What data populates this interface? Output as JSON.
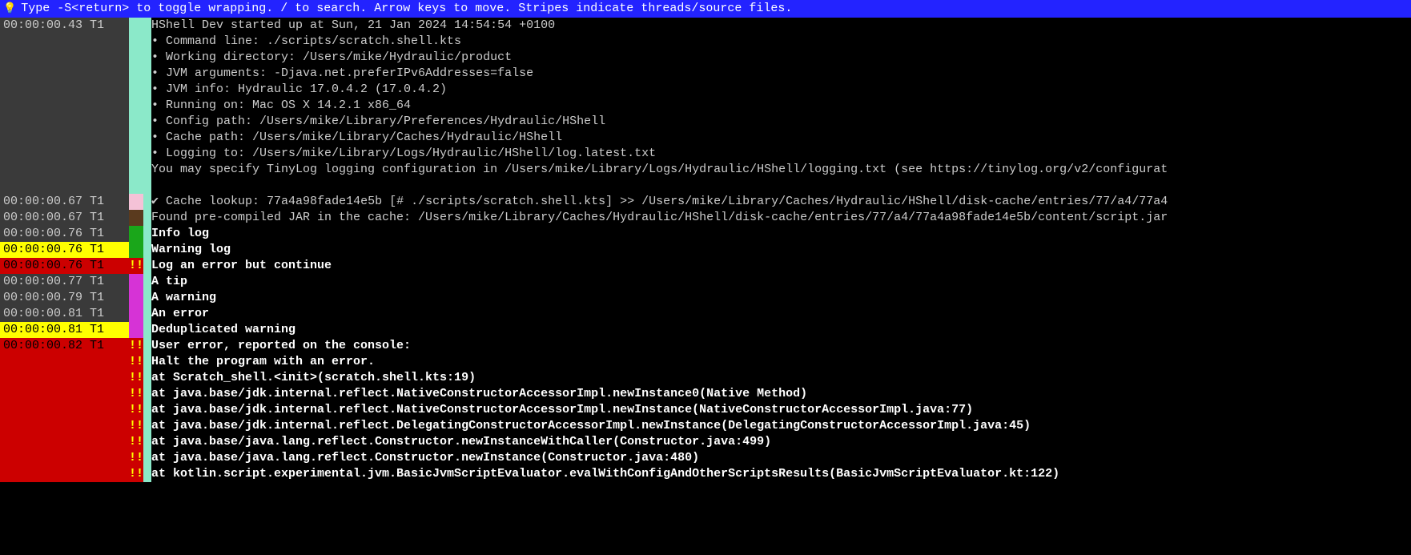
{
  "header": {
    "hint": "Type -S<return> to toggle wrapping. / to search. Arrow keys to move. Stripes indicate threads/source files."
  },
  "rows": [
    {
      "ts": "00:00:00.43 T1",
      "tsClass": "",
      "mark": "",
      "markClass": "",
      "msg": "HShell Dev started up at Sun, 21 Jan 2024 14:54:54 +0100",
      "bold": false
    },
    {
      "ts": "",
      "tsClass": "",
      "mark": "",
      "markClass": "",
      "msg": " • Command line:      ./scripts/scratch.shell.kts",
      "bold": false
    },
    {
      "ts": "",
      "tsClass": "",
      "mark": "",
      "markClass": "",
      "msg": " • Working directory: /Users/mike/Hydraulic/product",
      "bold": false
    },
    {
      "ts": "",
      "tsClass": "",
      "mark": "",
      "markClass": "",
      "msg": " • JVM arguments:     -Djava.net.preferIPv6Addresses=false",
      "bold": false
    },
    {
      "ts": "",
      "tsClass": "",
      "mark": "",
      "markClass": "",
      "msg": " • JVM info:          Hydraulic 17.0.4.2 (17.0.4.2)",
      "bold": false
    },
    {
      "ts": "",
      "tsClass": "",
      "mark": "",
      "markClass": "",
      "msg": " • Running on:        Mac OS X 14.2.1 x86_64",
      "bold": false
    },
    {
      "ts": "",
      "tsClass": "",
      "mark": "",
      "markClass": "",
      "msg": " • Config path:       /Users/mike/Library/Preferences/Hydraulic/HShell",
      "bold": false
    },
    {
      "ts": "",
      "tsClass": "",
      "mark": "",
      "markClass": "",
      "msg": " • Cache path:        /Users/mike/Library/Caches/Hydraulic/HShell",
      "bold": false
    },
    {
      "ts": "",
      "tsClass": "",
      "mark": "",
      "markClass": "",
      "msg": " • Logging to:        /Users/mike/Library/Logs/Hydraulic/HShell/log.latest.txt",
      "bold": false
    },
    {
      "ts": "",
      "tsClass": "",
      "mark": "",
      "markClass": "",
      "msg": "You may specify TinyLog logging configuration in /Users/mike/Library/Logs/Hydraulic/HShell/logging.txt (see https://tinylog.org/v2/configurat",
      "bold": false
    },
    {
      "ts": "",
      "tsClass": "",
      "mark": "",
      "markClass": "",
      "msg": "",
      "bold": false
    },
    {
      "ts": "00:00:00.67 T1",
      "tsClass": "",
      "mark": "",
      "markClass": "mark-pink",
      "msg": "✔ Cache lookup: 77a4a98fade14e5b [# ./scripts/scratch.shell.kts] >> /Users/mike/Library/Caches/Hydraulic/HShell/disk-cache/entries/77/a4/77a4",
      "bold": false
    },
    {
      "ts": "00:00:00.67 T1",
      "tsClass": "",
      "mark": "",
      "markClass": "mark-brown",
      "msg": "Found pre-compiled JAR in the cache: /Users/mike/Library/Caches/Hydraulic/HShell/disk-cache/entries/77/a4/77a4a98fade14e5b/content/script.jar",
      "bold": false
    },
    {
      "ts": "00:00:00.76 T1",
      "tsClass": "",
      "mark": "",
      "markClass": "mark-green",
      "msg": "Info log",
      "bold": true
    },
    {
      "ts": "00:00:00.76 T1",
      "tsClass": "ts-warn",
      "mark": "",
      "markClass": "mark-green",
      "msg": "Warning log",
      "bold": true
    },
    {
      "ts": "00:00:00.76 T1",
      "tsClass": "ts-err",
      "mark": "!!",
      "markClass": "mark-red",
      "msg": "Log an error but continue",
      "bold": true
    },
    {
      "ts": "00:00:00.77 T1",
      "tsClass": "",
      "mark": "",
      "markClass": "mark-magenta",
      "msg": "A tip",
      "bold": true
    },
    {
      "ts": "00:00:00.79 T1",
      "tsClass": "",
      "mark": "",
      "markClass": "mark-magenta",
      "msg": "A warning",
      "bold": true
    },
    {
      "ts": "00:00:00.81 T1",
      "tsClass": "",
      "mark": "",
      "markClass": "mark-magenta",
      "msg": "An error",
      "bold": true
    },
    {
      "ts": "00:00:00.81 T1",
      "tsClass": "ts-warn",
      "mark": "",
      "markClass": "mark-magenta",
      "msg": "Deduplicated warning",
      "bold": true
    },
    {
      "ts": "00:00:00.82 T1",
      "tsClass": "ts-err",
      "mark": "!!",
      "markClass": "mark-red",
      "msg": "User error, reported on the console:",
      "bold": true
    },
    {
      "ts": "",
      "tsClass": "ts-err",
      "mark": "!!",
      "markClass": "mark-red",
      "msg": "Halt the program with an error.",
      "bold": true
    },
    {
      "ts": "",
      "tsClass": "ts-err",
      "mark": "!!",
      "markClass": "mark-red",
      "msg": "   at Scratch_shell.<init>(scratch.shell.kts:19)",
      "bold": true
    },
    {
      "ts": "",
      "tsClass": "ts-err",
      "mark": "!!",
      "markClass": "mark-red",
      "msg": "   at java.base/jdk.internal.reflect.NativeConstructorAccessorImpl.newInstance0(Native Method)",
      "bold": true
    },
    {
      "ts": "",
      "tsClass": "ts-err",
      "mark": "!!",
      "markClass": "mark-red",
      "msg": "   at java.base/jdk.internal.reflect.NativeConstructorAccessorImpl.newInstance(NativeConstructorAccessorImpl.java:77)",
      "bold": true
    },
    {
      "ts": "",
      "tsClass": "ts-err",
      "mark": "!!",
      "markClass": "mark-red",
      "msg": "   at java.base/jdk.internal.reflect.DelegatingConstructorAccessorImpl.newInstance(DelegatingConstructorAccessorImpl.java:45)",
      "bold": true
    },
    {
      "ts": "",
      "tsClass": "ts-err",
      "mark": "!!",
      "markClass": "mark-red",
      "msg": "   at java.base/java.lang.reflect.Constructor.newInstanceWithCaller(Constructor.java:499)",
      "bold": true
    },
    {
      "ts": "",
      "tsClass": "ts-err",
      "mark": "!!",
      "markClass": "mark-red",
      "msg": "   at java.base/java.lang.reflect.Constructor.newInstance(Constructor.java:480)",
      "bold": true
    },
    {
      "ts": "",
      "tsClass": "ts-err",
      "mark": "!!",
      "markClass": "mark-red",
      "msg": "   at kotlin.script.experimental.jvm.BasicJvmScriptEvaluator.evalWithConfigAndOtherScriptsResults(BasicJvmScriptEvaluator.kt:122)",
      "bold": true
    }
  ]
}
